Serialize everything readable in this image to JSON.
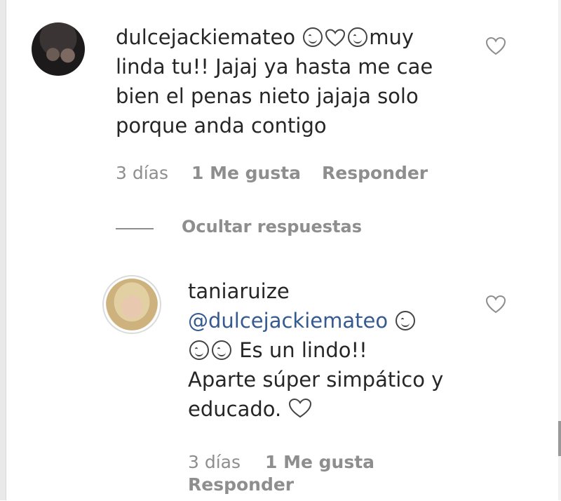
{
  "comments": [
    {
      "username": "dulcejackiemateo",
      "text_line1_tail": "muy",
      "text_rest": "linda tu!! Jajaj ya hasta me cae bien el penas nieto jajaja solo porque anda contigo",
      "time": "3 días",
      "likes": "1 Me gusta",
      "reply": "Responder"
    },
    {
      "username": "taniaruize",
      "mention": "@dulcejackiemateo",
      "text_a": "Es un lindo!!",
      "text_b": "Aparte súper simpático y",
      "text_c": "educado.",
      "time": "3 días",
      "likes": "1 Me gusta",
      "reply": "Responder"
    }
  ],
  "hide_replies": "Ocultar respuestas",
  "icons": {
    "like": "heart-outline-icon",
    "emoji_smile": "smiling-face-icon",
    "emoji_heart": "heart-emoji-icon",
    "emoji_grin": "grinning-squint-face-icon"
  },
  "colors": {
    "text": "#262626",
    "meta": "#8e8e8e",
    "mention": "#355a92"
  }
}
